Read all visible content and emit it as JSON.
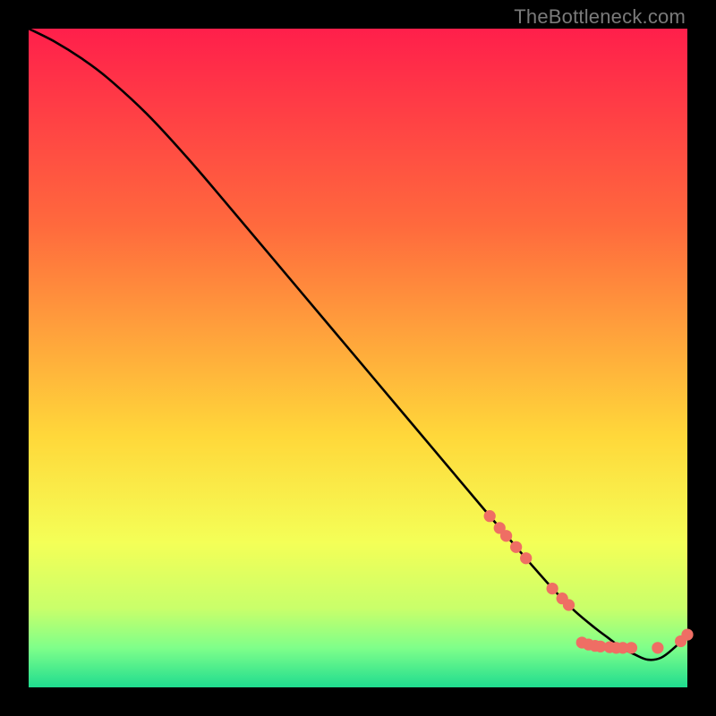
{
  "watermark": "TheBottleneck.com",
  "colors": {
    "bg_black": "#000000",
    "curve": "#000000",
    "marker": "#ef6e64",
    "grad_top": "#ff1f4b",
    "grad_mid1": "#ff6a3d",
    "grad_mid2": "#ffd83a",
    "grad_mid3": "#f4ff57",
    "grad_low1": "#c9ff6a",
    "grad_low2": "#7fff8a",
    "grad_bottom": "#1fdc8f"
  },
  "chart_data": {
    "type": "line",
    "title": "",
    "xlabel": "",
    "ylabel": "",
    "xlim": [
      0,
      100
    ],
    "ylim": [
      0,
      100
    ],
    "grid": false,
    "legend": false,
    "series": [
      {
        "name": "curve",
        "x": [
          0,
          4,
          8,
          12,
          18,
          24,
          30,
          38,
          46,
          54,
          62,
          70,
          76,
          80,
          83,
          86,
          88,
          90,
          92,
          94,
          96,
          98,
          100
        ],
        "y": [
          100,
          98,
          95.5,
          92.5,
          87,
          80.5,
          73.5,
          64,
          54.5,
          45,
          35.5,
          26,
          19,
          14.5,
          11.5,
          9,
          7.5,
          6,
          5,
          4.2,
          4.5,
          6,
          8
        ]
      }
    ],
    "markers": [
      {
        "x": 70,
        "y": 26
      },
      {
        "x": 71.5,
        "y": 24.2
      },
      {
        "x": 72.5,
        "y": 23
      },
      {
        "x": 74,
        "y": 21.3
      },
      {
        "x": 75.5,
        "y": 19.6
      },
      {
        "x": 79.5,
        "y": 15
      },
      {
        "x": 81,
        "y": 13.5
      },
      {
        "x": 82,
        "y": 12.5
      },
      {
        "x": 84,
        "y": 6.8
      },
      {
        "x": 85,
        "y": 6.5
      },
      {
        "x": 86,
        "y": 6.3
      },
      {
        "x": 86.8,
        "y": 6.2
      },
      {
        "x": 88.2,
        "y": 6.1
      },
      {
        "x": 89.2,
        "y": 6.0
      },
      {
        "x": 90.2,
        "y": 6.0
      },
      {
        "x": 91.5,
        "y": 6.0
      },
      {
        "x": 95.5,
        "y": 6.0
      },
      {
        "x": 99,
        "y": 7.0
      },
      {
        "x": 100,
        "y": 8.0
      }
    ]
  }
}
